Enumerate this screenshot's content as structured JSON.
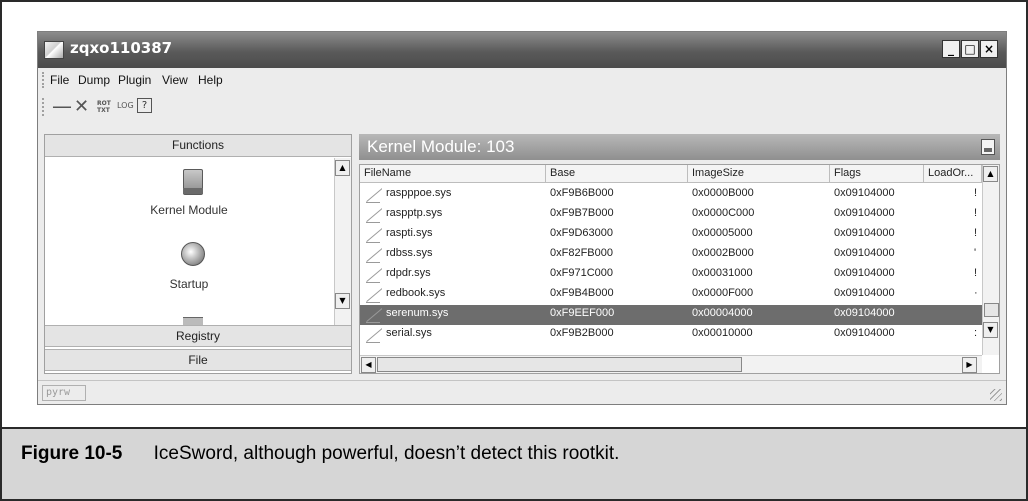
{
  "window": {
    "title": "zqxo110387",
    "controls": {
      "minimize": "_",
      "maximize": "□",
      "close": "×"
    }
  },
  "menu": [
    "File",
    "Dump",
    "Plugin",
    "View",
    "Help"
  ],
  "toolbar": {
    "icons": [
      "minus-icon",
      "close-icon",
      "txt-icon",
      "log-icon",
      "help-icon"
    ],
    "txt_label": "ROT\nTXT",
    "log_label": "LOG",
    "help_label": "?"
  },
  "left_panel": {
    "header": "Functions",
    "items": [
      {
        "label": "Kernel Module",
        "icon": "kernel-module-icon"
      },
      {
        "label": "Startup",
        "icon": "startup-icon"
      }
    ],
    "sections": [
      "Registry",
      "File"
    ]
  },
  "right_panel": {
    "title": "Kernel Module: 103",
    "columns": [
      "FileName",
      "Base",
      "ImageSize",
      "Flags",
      "LoadOr..."
    ],
    "rows": [
      {
        "name": "raspppoe.sys",
        "base": "0xF9B6B000",
        "size": "0x0000B000",
        "flags": "0x09104000",
        "load": "!"
      },
      {
        "name": "raspptp.sys",
        "base": "0xF9B7B000",
        "size": "0x0000C000",
        "flags": "0x09104000",
        "load": "!"
      },
      {
        "name": "raspti.sys",
        "base": "0xF9D63000",
        "size": "0x00005000",
        "flags": "0x09104000",
        "load": "!"
      },
      {
        "name": "rdbss.sys",
        "base": "0xF82FB000",
        "size": "0x0002B000",
        "flags": "0x09104000",
        "load": "'"
      },
      {
        "name": "rdpdr.sys",
        "base": "0xF971C000",
        "size": "0x00031000",
        "flags": "0x09104000",
        "load": "!"
      },
      {
        "name": "redbook.sys",
        "base": "0xF9B4B000",
        "size": "0x0000F000",
        "flags": "0x09104000",
        "load": "·"
      },
      {
        "name": "serenum.sys",
        "base": "0xF9EEF000",
        "size": "0x00004000",
        "flags": "0x09104000",
        "load": "",
        "selected": true
      },
      {
        "name": "serial.sys",
        "base": "0xF9B2B000",
        "size": "0x00010000",
        "flags": "0x09104000",
        "load": ":"
      }
    ]
  },
  "status": {
    "text": "pyrw"
  },
  "caption": {
    "label": "Figure 10-5",
    "text": "IceSword, although powerful, doesn’t detect this rootkit."
  }
}
